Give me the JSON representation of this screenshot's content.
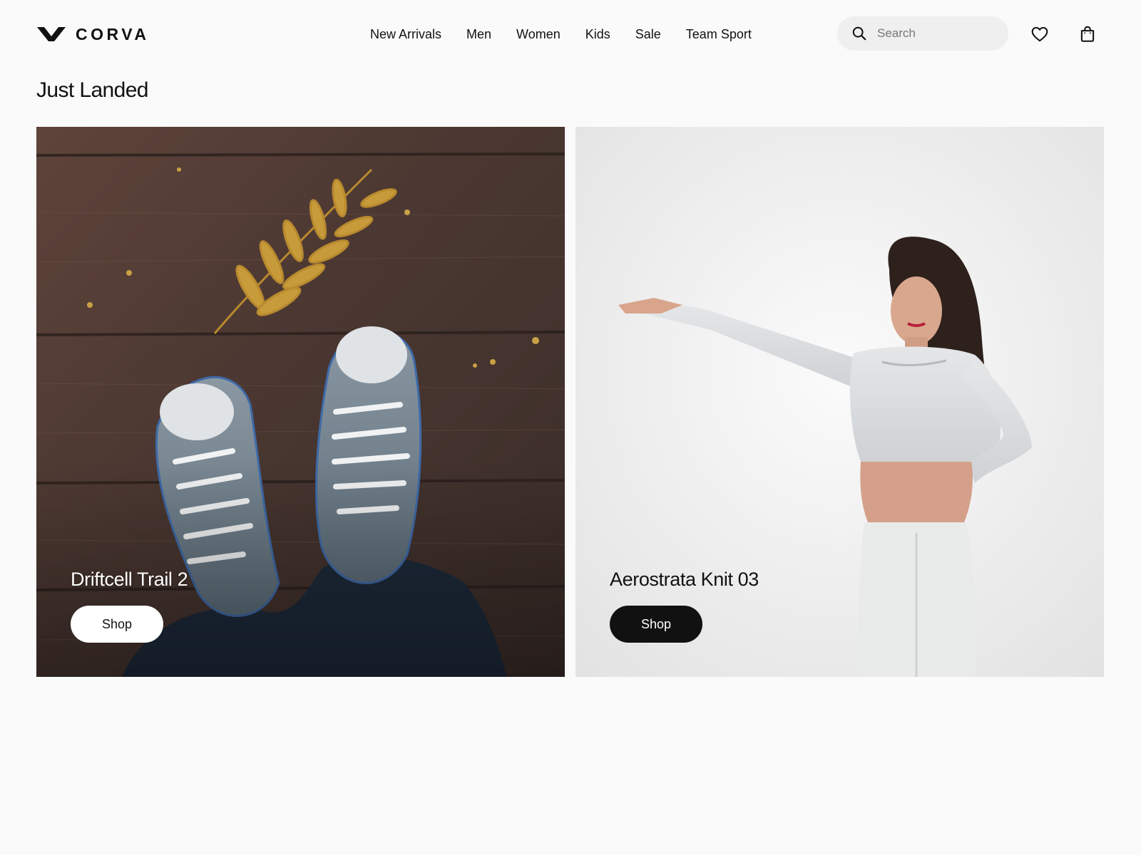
{
  "brand": {
    "name": "CORVA",
    "logo_icon": "v-chevron-logo-icon"
  },
  "nav": {
    "items": [
      {
        "label": "New Arrivals"
      },
      {
        "label": "Men"
      },
      {
        "label": "Women"
      },
      {
        "label": "Kids"
      },
      {
        "label": "Sale"
      },
      {
        "label": "Team Sport"
      }
    ]
  },
  "search": {
    "placeholder": "Search",
    "value": "",
    "icon": "search-icon"
  },
  "header_icons": {
    "favorites": "heart-icon",
    "bag": "shopping-bag-icon"
  },
  "section": {
    "title": "Just Landed"
  },
  "products": [
    {
      "name": "Driftcell Trail 2",
      "cta": "Shop",
      "button_style": "light",
      "image": "photo of feet in grey canvas high-top sneakers on dark wooden planks with a dried leaf sprig"
    },
    {
      "name": "Aerostrata Knit 03",
      "cta": "Shop",
      "button_style": "dark",
      "image": "photo of woman in light grey cropped long-sleeve top and white pants against white backdrop"
    }
  ],
  "colors": {
    "background": "#fafafa",
    "text": "#111111",
    "search_bg": "#efefef",
    "button_dark": "#111111",
    "button_light": "#ffffff"
  }
}
